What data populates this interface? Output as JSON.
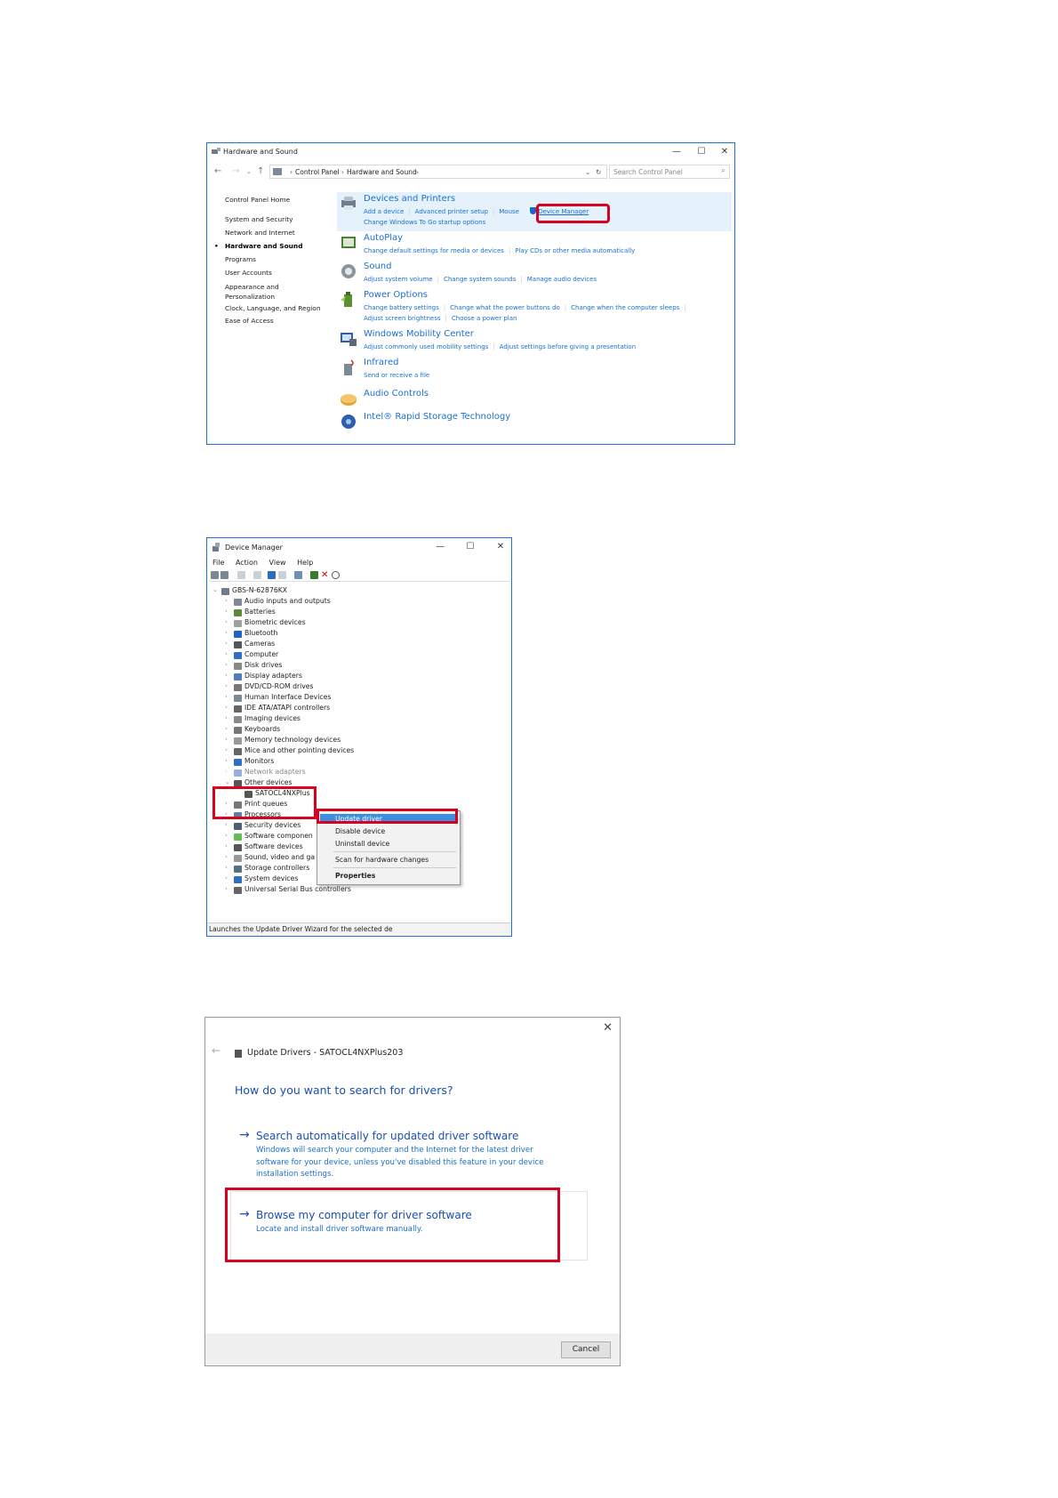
{
  "control_panel": {
    "title": "Hardware and Sound",
    "window_buttons": {
      "minimize": "—",
      "maximize": "☐",
      "close": "✕"
    },
    "breadcrumb": [
      "Control Panel",
      "Hardware and Sound"
    ],
    "search_placeholder": "Search Control Panel",
    "sidebar": {
      "home": "Control Panel Home",
      "items": [
        "System and Security",
        "Network and Internet",
        "Hardware and Sound",
        "Programs",
        "User Accounts",
        "Appearance and",
        "Personalization",
        "Clock, Language, and Region",
        "Ease of Access"
      ],
      "active": "Hardware and Sound"
    },
    "categories": [
      {
        "title": "Devices and Printers",
        "links": [
          "Add a device",
          "Advanced printer setup",
          "Mouse",
          "Device Manager"
        ],
        "links2": [
          "Change Windows To Go startup options"
        ]
      },
      {
        "title": "AutoPlay",
        "links": [
          "Change default settings for media or devices",
          "Play CDs or other media automatically"
        ]
      },
      {
        "title": "Sound",
        "links": [
          "Adjust system volume",
          "Change system sounds",
          "Manage audio devices"
        ]
      },
      {
        "title": "Power Options",
        "links": [
          "Change battery settings",
          "Change what the power buttons do",
          "Change when the computer sleeps"
        ],
        "links2": [
          "Adjust screen brightness",
          "Choose a power plan"
        ]
      },
      {
        "title": "Windows Mobility Center",
        "links": [
          "Adjust commonly used mobility settings",
          "Adjust settings before giving a presentation"
        ]
      },
      {
        "title": "Infrared",
        "links": [
          "Send or receive a file"
        ]
      },
      {
        "title": "Audio Controls",
        "links": []
      },
      {
        "title": "Intel® Rapid Storage Technology",
        "links": []
      }
    ]
  },
  "device_manager": {
    "title": "Device Manager",
    "menu": [
      "File",
      "Action",
      "View",
      "Help"
    ],
    "root": "GBS-N-62876KX",
    "nodes": [
      "Audio inputs and outputs",
      "Batteries",
      "Biometric devices",
      "Bluetooth",
      "Cameras",
      "Computer",
      "Disk drives",
      "Display adapters",
      "DVD/CD-ROM drives",
      "Human Interface Devices",
      "IDE ATA/ATAPI controllers",
      "Imaging devices",
      "Keyboards",
      "Memory technology devices",
      "Mice and other pointing devices",
      "Monitors",
      "Network adapters",
      "Other devices",
      "SATOCL4NXPlus",
      "Print queues",
      "Processors",
      "Security devices",
      "Software componen",
      "Software devices",
      "Sound, video and ga",
      "Storage controllers",
      "System devices",
      "Universal Serial Bus controllers"
    ],
    "status": "Launches the Update Driver Wizard for the selected de",
    "context_menu": [
      "Update driver",
      "Disable device",
      "Uninstall device",
      "Scan for hardware changes",
      "Properties"
    ]
  },
  "update_drivers": {
    "close": "✕",
    "back": "←",
    "title": "Update Drivers - SATOCL4NXPlus203",
    "question": "How do you want to search for drivers?",
    "options": [
      {
        "label": "Search automatically for updated driver software",
        "desc": "Windows will search your computer and the Internet for the latest driver software for your device, unless you've disabled this feature in your device installation settings."
      },
      {
        "label": "Browse my computer for driver software",
        "desc": "Locate and install driver software manually."
      }
    ],
    "cancel": "Cancel"
  },
  "colors": {
    "accent": "#1a6fd0",
    "highlight_red": "#d8001e",
    "selection": "#3b8ee0"
  }
}
